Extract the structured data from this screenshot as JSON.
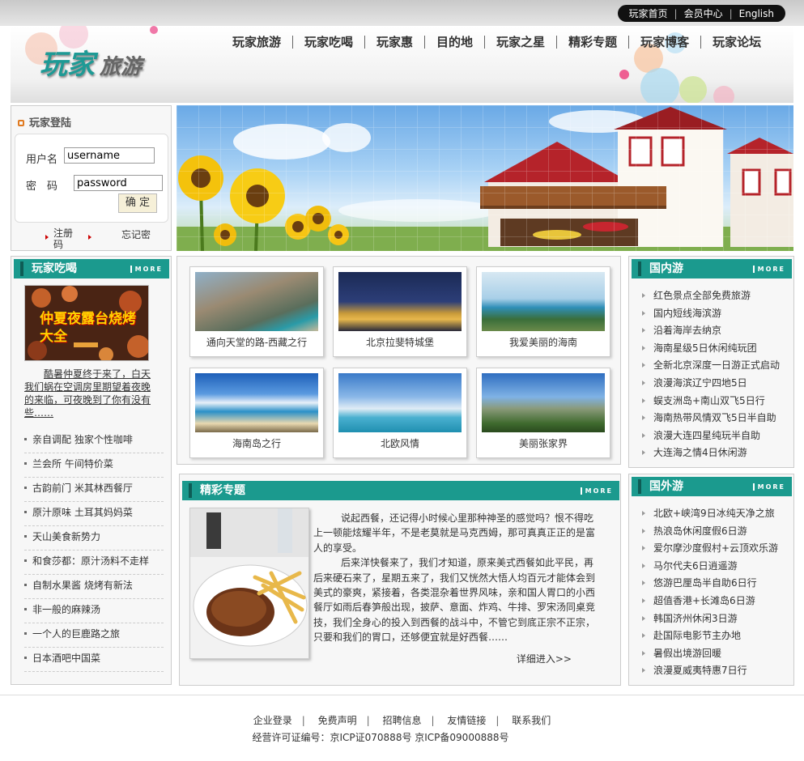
{
  "toplinks": [
    "玩家首页",
    "会员中心",
    "English"
  ],
  "logo": {
    "main": "玩家",
    "sub": "旅游"
  },
  "nav": [
    "玩家旅游",
    "玩家吃喝",
    "玩家惠",
    "目的地",
    "玩家之星",
    "精彩专题",
    "玩家博客",
    "玩家论坛"
  ],
  "login": {
    "title": "玩家登陆",
    "user_label": "用户名",
    "user_value": "username",
    "pass_label": "密　码",
    "pass_value": "password",
    "submit": "确 定",
    "register": "注册码",
    "forgot": "忘记密"
  },
  "eat": {
    "title": "玩家吃喝",
    "more": "MORE",
    "promo_text": "仲夏夜露台烧烤大全",
    "intro": "酷暑仲夏终于来了，白天我们蜗在空调房里期望着夜晚的来临，可夜晚到了你有没有些……",
    "items": [
      "亲自调配 独家个性咖啡",
      "兰会所 午间特价菜",
      "古韵前门 米其林西餐厅",
      "原汁原味 土耳其妈妈菜",
      "天山美食新势力",
      "和食莎都：原汁汤料不走样",
      "自制水果酱 烧烤有新法",
      "非一般的麻辣汤",
      "一个人的巨鹿路之旅",
      "日本酒吧中国菜"
    ]
  },
  "photos": [
    {
      "caption": "通向天堂的路-西藏之行"
    },
    {
      "caption": "北京拉斐特城堡"
    },
    {
      "caption": "我爱美丽的海南"
    },
    {
      "caption": "海南岛之行"
    },
    {
      "caption": "北欧风情"
    },
    {
      "caption": "美丽张家界"
    }
  ],
  "special": {
    "title": "精彩专题",
    "more": "MORE",
    "p1": "说起西餐，还记得小时候心里那种神圣的感觉吗？恨不得吃上一顿能炫耀半年，不是老莫就是马克西姆，那可真真正正的是富人的享受。",
    "p2": "后来洋快餐来了，我们才知道，原来美式西餐如此平民，再后来硬石来了，星期五来了，我们又恍然大悟人均百元才能体会到美式的豪爽，紧接着，各类混杂着世界风味，亲和国人胃口的小西餐厅如雨后春笋般出现，披萨、意面、炸鸡、牛排、罗宋汤同桌竞技，我们全身心的投入到西餐的战斗中，不管它到底正宗不正宗，只要和我们的胃口，还够便宜就是好西餐……",
    "detail": "详细进入>>"
  },
  "domestic": {
    "title": "国内游",
    "more": "MORE",
    "items": [
      "红色景点全部免费旅游",
      "国内短线海滨游",
      "沿着海岸去纳京",
      "海南星级5日休闲纯玩团",
      "全新北京深度一日游正式启动",
      "浪漫海滨辽宁四地5日",
      "蜈支洲岛+南山双飞5日行",
      "海南热带风情双飞5日半自助",
      "浪漫大连四星纯玩半自助",
      "大连海之情4日休闲游"
    ]
  },
  "abroad": {
    "title": "国外游",
    "more": "MORE",
    "items": [
      "北欧+峡湾9日冰纯天净之旅",
      "热浪岛休闲度假6日游",
      "爱尔摩沙度假村+云顶欢乐游",
      "马尔代夫6日逍遥游",
      "悠游巴厘岛半自助6日行",
      "超值香港+长滩岛6日游",
      "韩国济州休闲3日游",
      "赴国际电影节主办地",
      "暑假出境游回暖",
      "浪漫夏威夷特惠7日行"
    ]
  },
  "footer": {
    "links": [
      "企业登录",
      "免费声明",
      "招聘信息",
      "友情链接",
      "联系我们"
    ],
    "copy": "经营许可证编号：京ICP证070888号 京ICP备09000888号"
  }
}
